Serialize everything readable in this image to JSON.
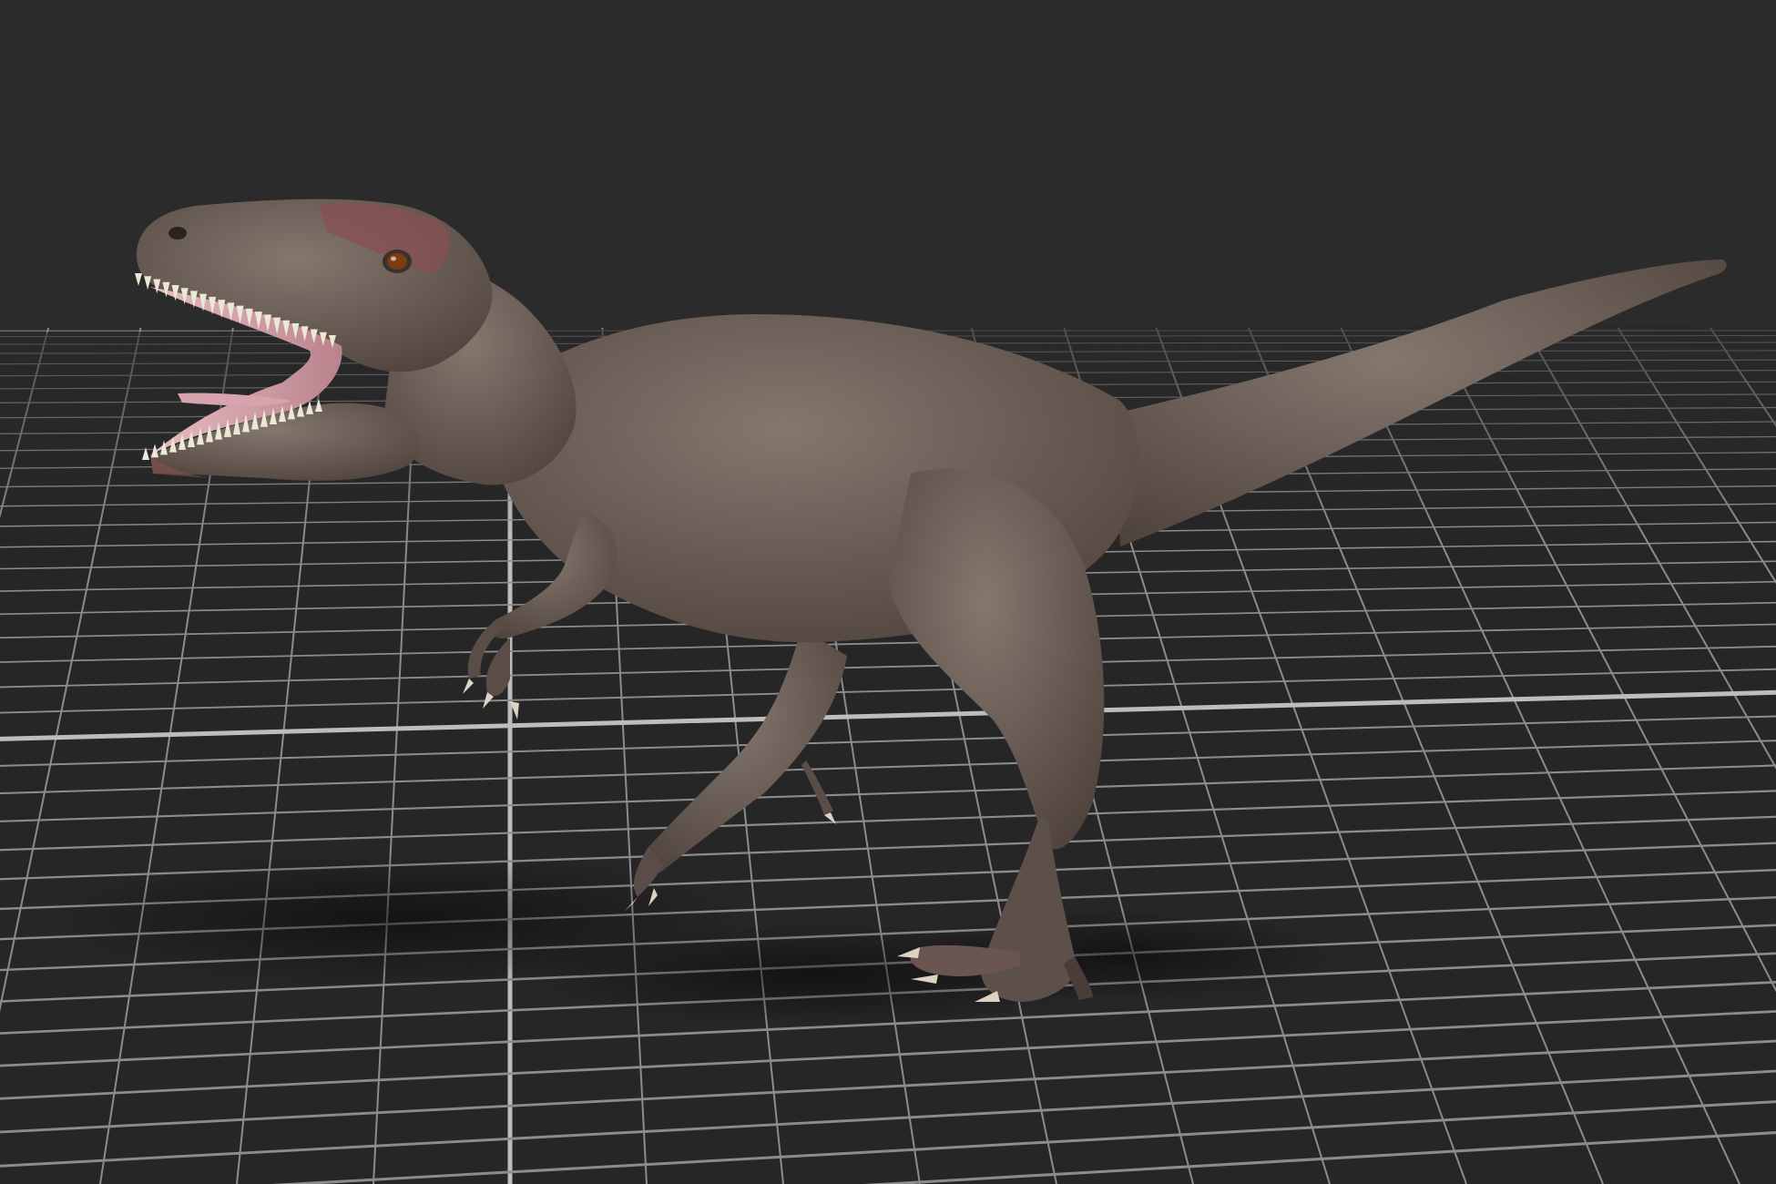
{
  "viewport": {
    "background_color": "#2b2b2b",
    "floor_color": "#262626",
    "grid_line_color": "#8c8c8c",
    "grid_axis_color": "#bdbdbd",
    "show_grid": true,
    "camera": "perspective"
  },
  "model": {
    "subject": "theropod-dinosaur",
    "pose": "walking-mouth-open",
    "skin_color": "#6f625a",
    "skin_shadow_color": "#4f433d",
    "head_tint_color": "#8a4f52",
    "mouth_color": "#d7a4ad",
    "teeth_color": "#ece8d6",
    "eye_color": "#7a3c12",
    "claw_color": "#ded3c3"
  }
}
